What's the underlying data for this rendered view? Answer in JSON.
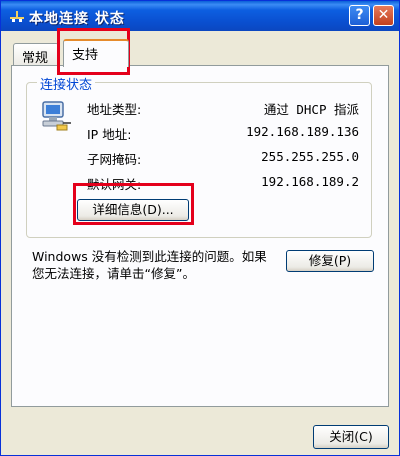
{
  "window": {
    "title": "本地连接 状态",
    "help_button": "?",
    "close_button": "✕"
  },
  "tabs": [
    {
      "label": "常规",
      "active": false
    },
    {
      "label": "支持",
      "active": true
    }
  ],
  "connection_status": {
    "legend": "连接状态",
    "rows": [
      {
        "label": "地址类型:",
        "value": "通过 DHCP 指派"
      },
      {
        "label": "IP 地址:",
        "value": "192.168.189.136"
      },
      {
        "label": "子网掩码:",
        "value": "255.255.255.0"
      },
      {
        "label": "默认网关:",
        "value": "192.168.189.2"
      }
    ],
    "details_button": "详细信息(D)..."
  },
  "repair": {
    "text": "Windows 没有检测到此连接的问题。如果您无法连接，请单击“修复”。",
    "button": "修复(P)"
  },
  "footer": {
    "close_button": "关闭(C)"
  },
  "colors": {
    "titlebar": "#0a5fd8",
    "group_legend": "#0046d5",
    "highlight": "#e4001b"
  }
}
